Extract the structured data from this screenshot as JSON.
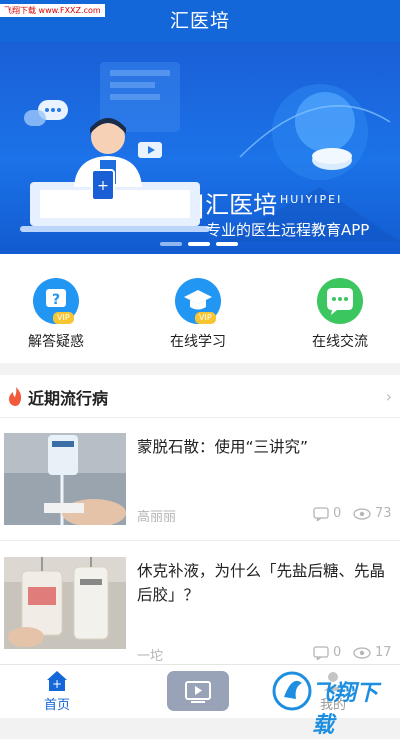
{
  "watermark": "飞翔下载 www.FXXZ.com",
  "header": {
    "title": "汇医培"
  },
  "banner": {
    "brand": "|汇医培",
    "pinyin": "HUIYIPEI",
    "slogan": "专业的医生远程教育APP"
  },
  "quick_actions": [
    {
      "label": "解答疑惑",
      "icon": "question-icon",
      "badge": "VIP",
      "color": "#2196f3"
    },
    {
      "label": "在线学习",
      "icon": "graduation-cap-icon",
      "badge": "VIP",
      "color": "#2196f3"
    },
    {
      "label": "在线交流",
      "icon": "chat-bubble-icon",
      "badge": "",
      "color": "#3bc660"
    }
  ],
  "section": {
    "title": "近期流行病",
    "icon": "flame-icon"
  },
  "articles": [
    {
      "title": "蒙脱石散：使用“三讲究”",
      "author": "高丽丽",
      "comments": "0",
      "views": "73"
    },
    {
      "title": "休克补液，为什么「先盐后糖、先晶后胶」？",
      "author": "一坨",
      "comments": "0",
      "views": "17"
    }
  ],
  "tabbar": {
    "items": [
      {
        "label": "首页",
        "icon": "home-icon"
      },
      {
        "label": "",
        "icon": "video-icon"
      },
      {
        "label": "我的",
        "icon": "user-icon"
      }
    ]
  },
  "overlay_logo": "飞翔下载"
}
